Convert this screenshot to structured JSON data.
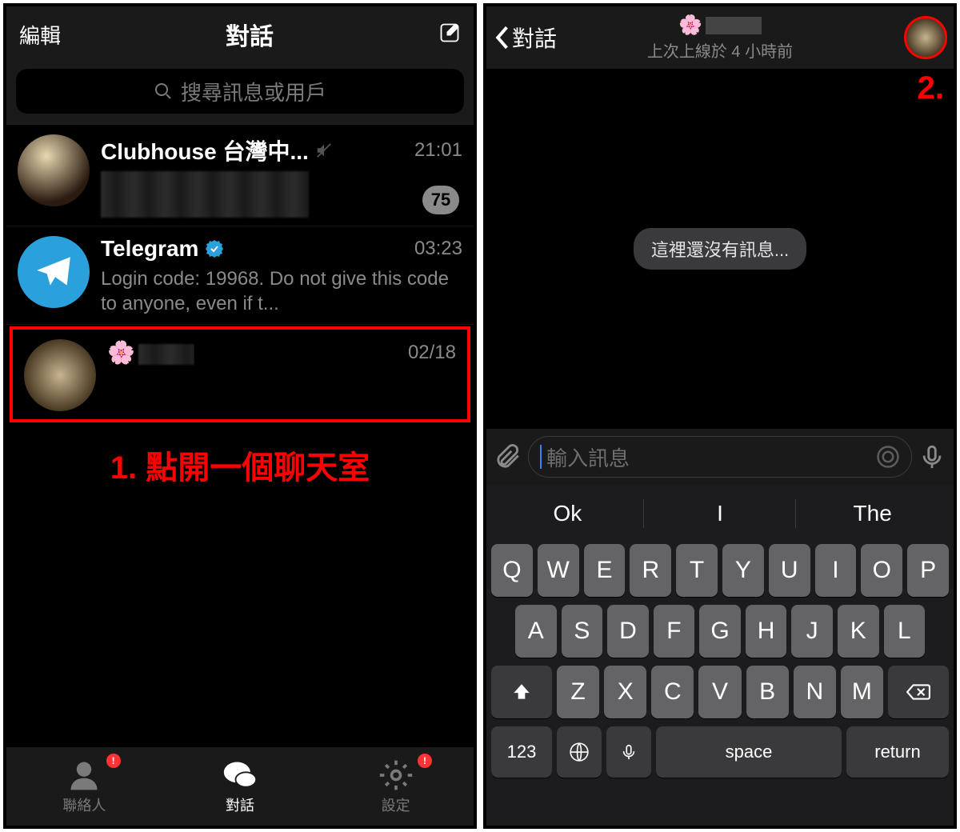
{
  "annotation": {
    "step1": "1. 點開一個聊天室",
    "step2": "2."
  },
  "left": {
    "edit": "編輯",
    "title": "對話",
    "search_placeholder": "搜尋訊息或用戶",
    "chats": [
      {
        "name": "Clubhouse 台灣中...",
        "time": "21:01",
        "muted": true,
        "unread": "75",
        "preview": ""
      },
      {
        "name": "Telegram",
        "time": "03:23",
        "verified": true,
        "preview": "Login code: 19968. Do not give this code to anyone, even if t..."
      },
      {
        "name_emoji": "🌸",
        "time": "02/18",
        "highlight": true
      }
    ],
    "tabs": {
      "contacts": "聯絡人",
      "chats": "對話",
      "settings": "設定"
    }
  },
  "right": {
    "back": "對話",
    "name_emoji": "🌸",
    "status": "上次上線於 4 小時前",
    "empty": "這裡還沒有訊息...",
    "input_placeholder": "輸入訊息"
  },
  "keyboard": {
    "suggestions": [
      "Ok",
      "I",
      "The"
    ],
    "rows": [
      [
        "Q",
        "W",
        "E",
        "R",
        "T",
        "Y",
        "U",
        "I",
        "O",
        "P"
      ],
      [
        "A",
        "S",
        "D",
        "F",
        "G",
        "H",
        "J",
        "K",
        "L"
      ],
      [
        "Z",
        "X",
        "C",
        "V",
        "B",
        "N",
        "M"
      ]
    ],
    "numkey": "123",
    "space": "space",
    "return": "return"
  }
}
